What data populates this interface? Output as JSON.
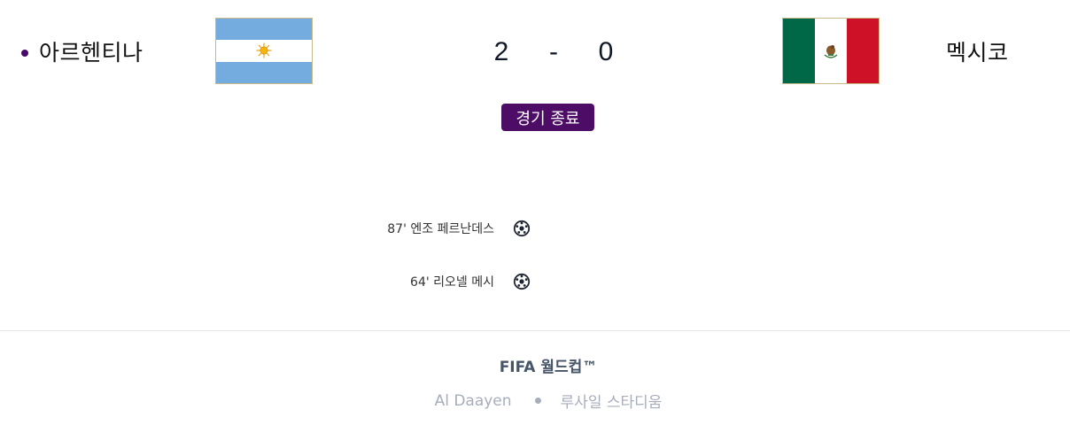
{
  "match": {
    "home_team": "아르헨티나",
    "away_team": "멕시코",
    "home_score": "2",
    "score_separator": "-",
    "away_score": "0",
    "status": "경기 종료"
  },
  "flags": {
    "home_icon": "argentina-flag",
    "away_icon": "mexico-flag"
  },
  "goals": [
    {
      "text": "87' 엔조 페르난데스",
      "icon": "soccer-ball-icon"
    },
    {
      "text": "64' 리오넬 메시",
      "icon": "soccer-ball-icon"
    }
  ],
  "footer": {
    "tournament": "FIFA 월드컵™",
    "city": "Al Daayen",
    "stadium": "루사일 스타디움"
  },
  "colors": {
    "accent": "#4d0c66",
    "score_text": "#101828",
    "argentina_blue": "#74acdf",
    "mexico_green": "#006847",
    "mexico_red": "#ce1126"
  }
}
